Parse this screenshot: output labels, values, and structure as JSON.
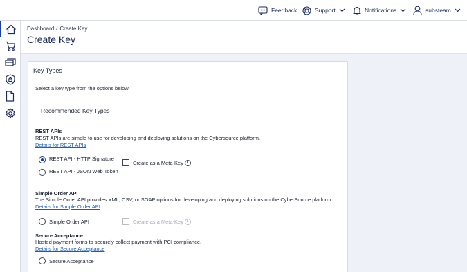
{
  "topbar": {
    "feedback": "Feedback",
    "support": "Support",
    "notifications": "Notifications",
    "user": "substeam"
  },
  "sidebar": {
    "items": [
      {
        "icon": "home-icon",
        "active": true
      },
      {
        "icon": "cart-icon"
      },
      {
        "icon": "payments-icon"
      },
      {
        "icon": "shield-icon"
      },
      {
        "icon": "document-icon"
      },
      {
        "icon": "gear-icon"
      }
    ]
  },
  "header": {
    "breadcrumb_root": "Dashboard",
    "breadcrumb_sep": "/",
    "breadcrumb_current": "Create Key",
    "title": "Create Key"
  },
  "card": {
    "title": "Key Types",
    "intro": "Select a key type from the options below.",
    "recommended": "Recommended Key Types",
    "sections": {
      "rest": {
        "title": "REST APIs",
        "desc": "REST APIs are simple to use for developing and deploying solutions on the Cybersource platform.",
        "link": "Details for REST APIs",
        "options": [
          "REST API - HTTP Signature",
          "REST API - JSON Web Token"
        ],
        "selected": "REST API - HTTP Signature",
        "meta_key": "Create as a Meta-Key"
      },
      "simple": {
        "title": "Simple Order API",
        "desc": "The Simple Order API provides XML, CSV, or SOAP options for developing and deploying solutions on the CyberSource platform.",
        "link": "Details for Simple Order API",
        "option": "Simple Order API",
        "meta_key": "Create as a Meta-Key"
      },
      "secure": {
        "title": "Secure Acceptance",
        "desc": "Hosted payment forms to securely collect payment with PCI compliance.",
        "link": "Details for Secure Acceptance",
        "option": "Secure Acceptance"
      }
    }
  },
  "colors": {
    "brand": "#1a2b5e",
    "accent": "#1a3f9c",
    "link": "#1a5fb4",
    "background": "#eef2f8"
  }
}
